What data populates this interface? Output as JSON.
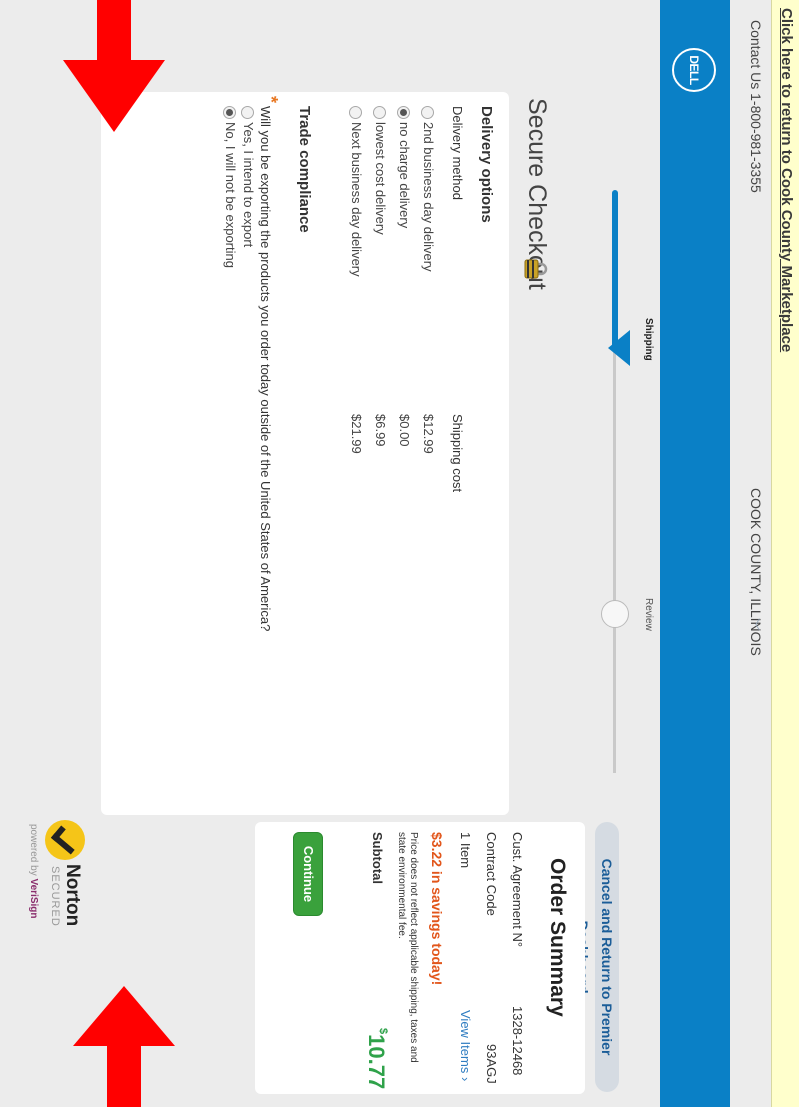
{
  "banner": {
    "return_link": "Click here to return to Cook County Marketplace"
  },
  "header": {
    "contact": "Contact Us 1-800-981-3355",
    "county": "COOK COUNTY, ILLINOIS",
    "logo_text": "DELL"
  },
  "progress": {
    "steps": [
      {
        "label": "Shipping",
        "state": "current"
      },
      {
        "label": "Review",
        "state": "upcoming"
      }
    ]
  },
  "cancel_link": "Cancel and Return to Premier Dashboard",
  "page_title": "Secure Checkout",
  "delivery": {
    "section_title": "Delivery options",
    "method_header": "Delivery method",
    "cost_header": "Shipping cost",
    "options": [
      {
        "label": "2nd business day delivery",
        "cost": "$12.99",
        "selected": false
      },
      {
        "label": "no charge delivery",
        "cost": "$0.00",
        "selected": true
      },
      {
        "label": "lowest cost delivery",
        "cost": "$6.99",
        "selected": false
      },
      {
        "label": "Next business day delivery",
        "cost": "$21.99",
        "selected": false
      }
    ]
  },
  "trade": {
    "section_title": "Trade compliance",
    "required_mark": "*",
    "question": "Will you be exporting the products you order today outside of the United States of America?",
    "options": [
      {
        "label": "Yes, I intend to export",
        "selected": false
      },
      {
        "label": "No, I will not be exporting",
        "selected": true
      }
    ]
  },
  "summary": {
    "title": "Order Summary",
    "agreement_label": "Cust. Agreement N°",
    "agreement_value": "1328-12468",
    "contract_label": "Contract Code",
    "contract_value": "93AGJ",
    "items_label": "1 Item",
    "view_items": "View Items ›",
    "savings": "$3.22 in savings today!",
    "disclaimer": "Price does not reflect applicable shipping, taxes and state environmental fee.",
    "subtotal_label": "Subtotal",
    "subtotal_currency": "$",
    "subtotal_value": "10.77",
    "continue_label": "Continue"
  },
  "norton": {
    "brand": "Norton",
    "secured": "SECURED",
    "powered_prefix": "powered by ",
    "powered_brand": "VeriSign"
  },
  "colors": {
    "dell_blue": "#0a80c6",
    "banner_yellow": "#ffffcc",
    "continue_green": "#3aa13c",
    "savings_orange": "#e2561b",
    "subtotal_green": "#2fa24a",
    "arrow_red": "#ff0000"
  }
}
